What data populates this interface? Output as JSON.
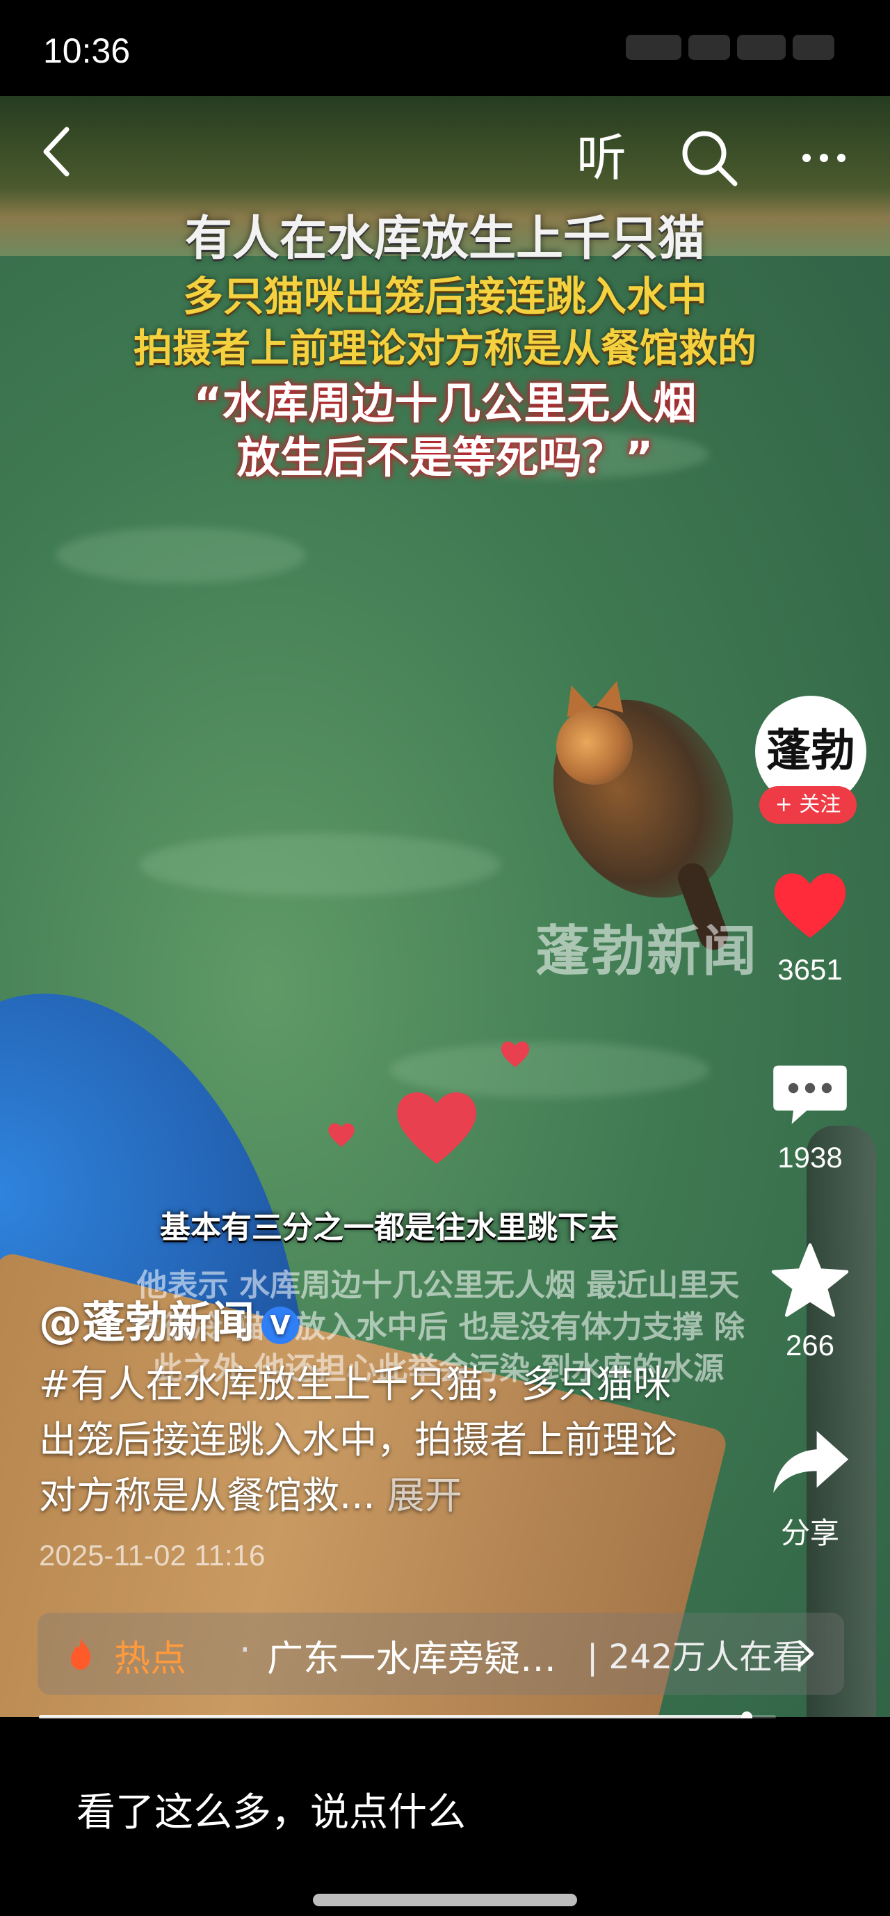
{
  "status_bar": {
    "time": "10:36"
  },
  "top_nav": {
    "listen_label": "听"
  },
  "video": {
    "headline": {
      "line1": "有人在水库放生上千只猫",
      "line2": "多只猫咪出笼后接连跳入水中",
      "line3": "拍摄者上前理论对方称是从餐馆救的",
      "line4": "“水库周边十几公里无人烟",
      "line5": "放生后不是等死吗？”"
    },
    "watermark": "蓬勃新闻",
    "subtitle": "基本有三分之一都是往水里跳下去",
    "overlay_text": "他表示 水库周边十几公里无人烟 最近山里天气很冷 猫咪放入水中后 也是没有体力支撑 除此之外 他还担心此举会污染 到水库的水源"
  },
  "right_rail": {
    "avatar_text": "蓬勃",
    "follow_label": "+ 关注",
    "like_count": "3651",
    "comment_count": "1938",
    "favorite_count": "266",
    "share_label": "分享"
  },
  "post": {
    "author": "@蓬勃新闻",
    "description": "#有人在水库放生上千只猫，多只猫咪出笼后接连跳入水中，拍摄者上前理论对方称是从餐馆救...",
    "more_label": "展开",
    "date": "2025-11-02 11:16"
  },
  "hot_bar": {
    "label": "热点",
    "title": "广东一水库旁疑…",
    "viewers": "| 242万人在看"
  },
  "comment_bar": {
    "placeholder": "看了这么多，说点什么"
  },
  "progress": {
    "fraction": 0.96
  },
  "colors": {
    "like_red": "#ff2a3a",
    "follow_red": "#ef3b46",
    "hot_orange": "#ff9a3d"
  }
}
